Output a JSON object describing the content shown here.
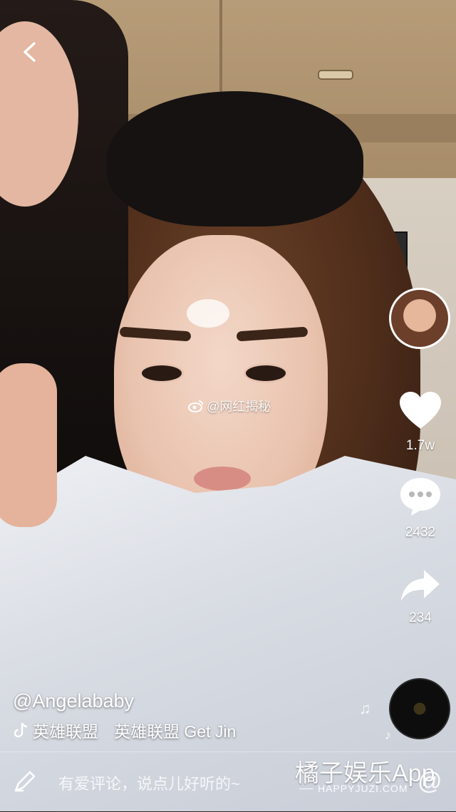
{
  "video": {
    "watermark_text": "@网红揭秘"
  },
  "actions": {
    "likes": "1.7w",
    "comments": "2432",
    "shares": "234"
  },
  "author": {
    "handle": "@Angelababy"
  },
  "music": {
    "line_part1": "英雄联盟",
    "line_part2": "英雄联盟 Get Jin"
  },
  "comment_bar": {
    "placeholder": "有爱评论，说点儿好听的~"
  },
  "branding": {
    "name": "橘子娱乐App",
    "url": "HAPPYJUZI.COM"
  },
  "colors": {
    "text": "#ffffff",
    "like_fill": "#ffffff"
  },
  "icons": [
    "back-icon",
    "heart-icon",
    "comment-icon",
    "share-icon",
    "tiktok-icon",
    "weibo-icon",
    "pen-icon",
    "music-note-icon",
    "at-icon"
  ]
}
